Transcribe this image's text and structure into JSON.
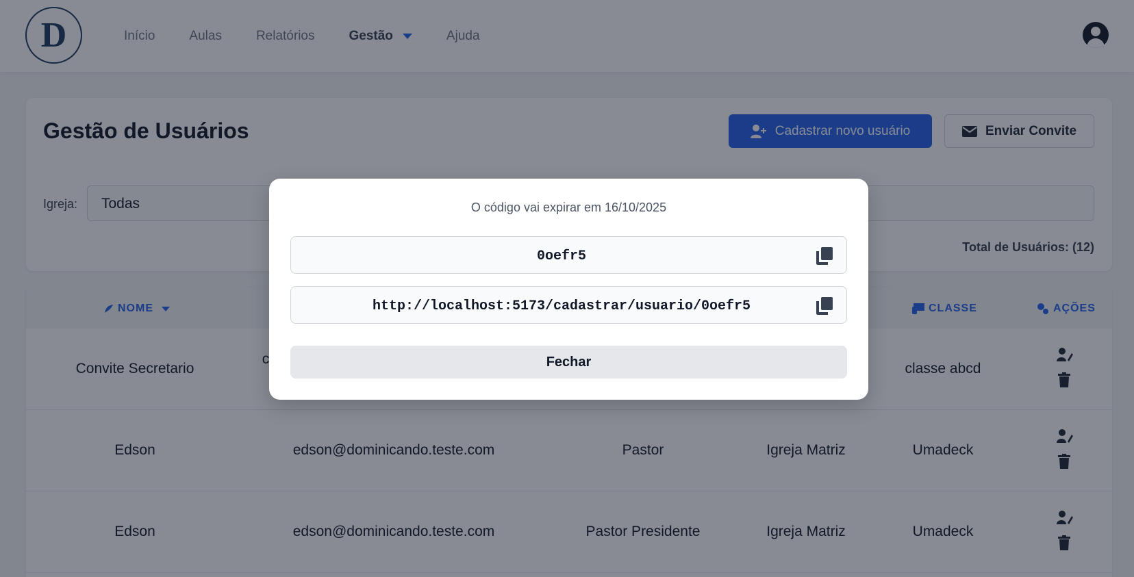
{
  "header": {
    "logo_letter": "D",
    "nav": [
      {
        "label": "Início"
      },
      {
        "label": "Aulas"
      },
      {
        "label": "Relatórios"
      },
      {
        "label": "Gestão"
      },
      {
        "label": "Ajuda"
      }
    ]
  },
  "management": {
    "title": "Gestão de Usuários",
    "register_button": "Cadastrar novo usuário",
    "invite_button": "Enviar Convite",
    "church_filter_label": "Igreja:",
    "church_filter_value": "Todas",
    "total_users": "Total de Usuários: (12)"
  },
  "table": {
    "headers": {
      "name": "NOME",
      "class": "CLASSE",
      "actions": "AÇÕES"
    },
    "rows": [
      {
        "name": "Convite Secretario",
        "email": "c",
        "role": "",
        "church": "",
        "class": "classe abcd"
      },
      {
        "name": "Edson",
        "email": "edson@dominicando.teste.com",
        "role": "Pastor",
        "church": "Igreja Matriz",
        "class": "Umadeck"
      },
      {
        "name": "Edson",
        "email": "edson@dominicando.teste.com",
        "role": "Pastor Presidente",
        "church": "Igreja Matriz",
        "class": "Umadeck"
      }
    ]
  },
  "modal": {
    "expire_text": "O código vai expirar em 16/10/2025",
    "code": "0oefr5",
    "link": "http://localhost:5173/cadastrar/usuario/0oefr5",
    "close_label": "Fechar"
  },
  "colors": {
    "primary": "#2563eb",
    "overlay": "rgba(17,24,39,0.5)"
  }
}
